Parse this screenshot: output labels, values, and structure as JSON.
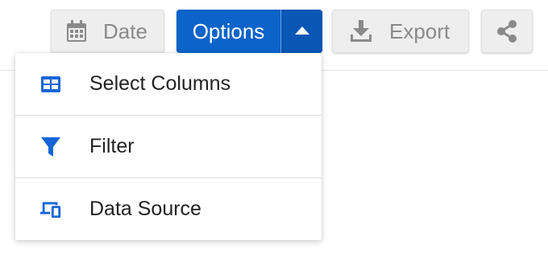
{
  "toolbar": {
    "date_label": "Date",
    "options_label": "Options",
    "export_label": "Export"
  },
  "options_menu": {
    "items": [
      {
        "label": "Select Columns",
        "icon": "table-icon"
      },
      {
        "label": "Filter",
        "icon": "filter-icon"
      },
      {
        "label": "Data Source",
        "icon": "devices-icon"
      }
    ]
  },
  "colors": {
    "primary": "#0c63c9",
    "primary_dark": "#0a57b5",
    "menu_icon": "#1565d8",
    "button_grey": "#eeeeee",
    "button_text": "#8a8a8a"
  }
}
